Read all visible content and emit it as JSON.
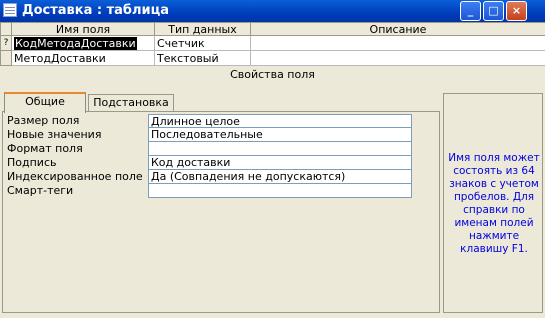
{
  "window": {
    "title": "Доставка : таблица",
    "minimize_glyph": "_",
    "maximize_glyph": "□",
    "close_glyph": "×"
  },
  "grid": {
    "columns": [
      "Имя поля",
      "Тип данных",
      "Описание"
    ],
    "rows": [
      {
        "marker": "?",
        "name": "КодМетодаДоставки",
        "type": "Счетчик",
        "description": ""
      },
      {
        "marker": "",
        "name": "МетодДоставки",
        "type": "Текстовый",
        "description": ""
      }
    ]
  },
  "section_label": "Свойства поля",
  "tabs": [
    "Общие",
    "Подстановка"
  ],
  "properties": [
    {
      "label": "Размер поля",
      "value": "Длинное целое"
    },
    {
      "label": "Новые значения",
      "value": "Последовательные"
    },
    {
      "label": "Формат поля",
      "value": ""
    },
    {
      "label": "Подпись",
      "value": "Код доставки"
    },
    {
      "label": "Индексированное поле",
      "value": "Да (Совпадения не допускаются)"
    },
    {
      "label": "Смарт-теги",
      "value": ""
    }
  ],
  "help_text": "Имя поля может состоять из 64 знаков с учетом пробелов. Для справки по именам полей нажмите клавишу F1.",
  "colors": {
    "titlebar": "#0a5fd8",
    "help_text": "#0000e0",
    "active_tab_accent": "#e68b2c",
    "panel_bg": "#ece9d8"
  }
}
